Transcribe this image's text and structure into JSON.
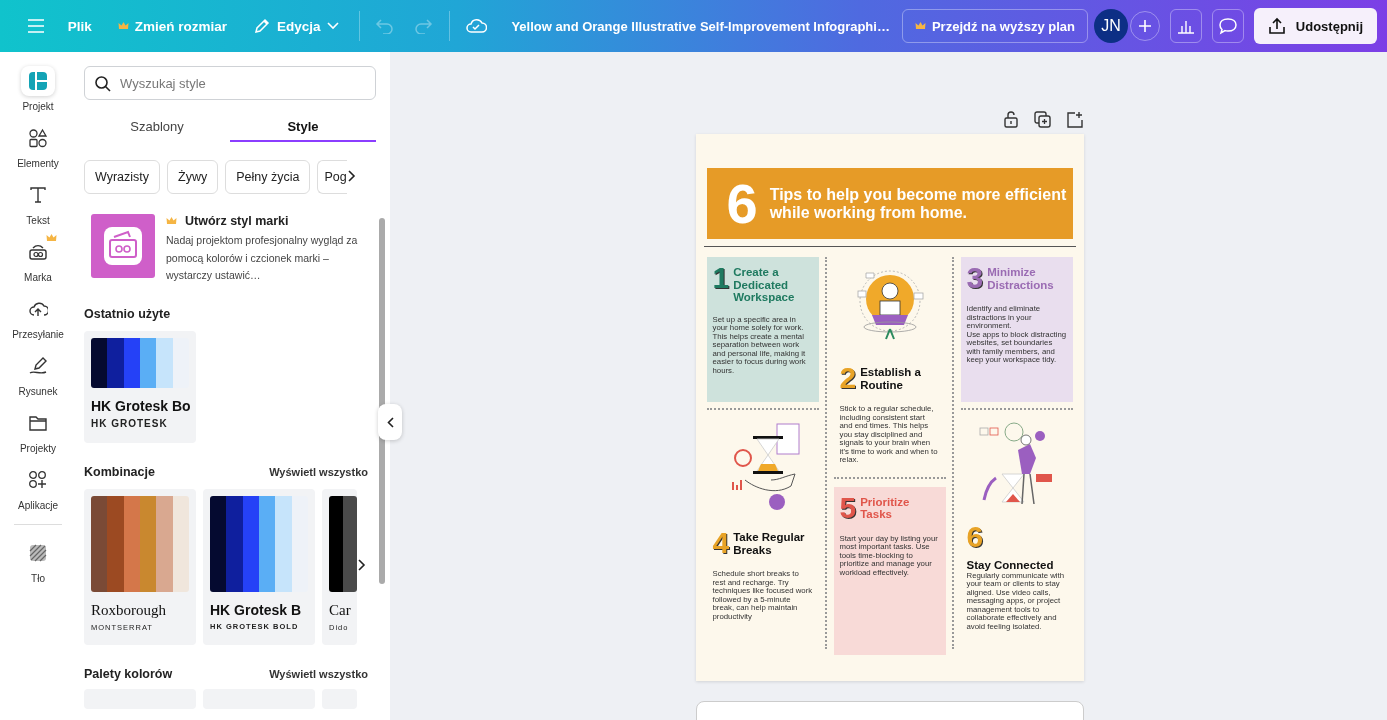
{
  "topbar": {
    "menu": [
      {
        "label": "Plik",
        "kind": "plain"
      },
      {
        "label": "Zmień rozmiar",
        "kind": "premium"
      },
      {
        "label": "Edycja",
        "kind": "edit"
      }
    ],
    "history": [
      {
        "kind": "undo",
        "disabled": true
      },
      {
        "kind": "redo",
        "disabled": true
      }
    ],
    "title": "Yellow and Orange Illustrative Self-Improvement Infographi…",
    "upgrade": "Przejdź na wyższy plan",
    "avatar": "JN",
    "share": "Udostępnij"
  },
  "rail": [
    {
      "label": "Projekt",
      "kind": "design",
      "selected": true,
      "premium": false
    },
    {
      "label": "Elementy",
      "kind": "elements",
      "selected": false,
      "premium": false
    },
    {
      "label": "Tekst",
      "kind": "text",
      "selected": false,
      "premium": false
    },
    {
      "label": "Marka",
      "kind": "brand",
      "selected": false,
      "premium": true
    },
    {
      "label": "Przesyłanie",
      "kind": "upload",
      "selected": false,
      "premium": false
    },
    {
      "label": "Rysunek",
      "kind": "draw",
      "selected": false,
      "premium": false
    },
    {
      "label": "Projekty",
      "kind": "projects",
      "selected": false,
      "premium": false
    },
    {
      "label": "Aplikacje",
      "kind": "apps",
      "selected": false,
      "premium": false
    },
    {
      "label": "Tło",
      "kind": "background",
      "selected": false,
      "premium": false
    }
  ],
  "panel": {
    "search": {
      "placeholder": "Wyszukaj style"
    },
    "tabs": [
      {
        "label": "Szablony",
        "selected": false
      },
      {
        "label": "Style",
        "selected": true
      }
    ],
    "chips": [
      "Wyrazisty",
      "Żywy",
      "Pełny życia",
      "Pog"
    ],
    "brand": {
      "title": "Utwórz styl marki",
      "text": "Nadaj projektom profesjonalny wygląd za pomocą kolorów i czcionek marki – wystarczy ustawić…"
    },
    "recent": {
      "title": "Ostatnio użyte",
      "items": [
        {
          "swatches": [
            {
              "color": "#050a30"
            },
            {
              "color": "#0f1f9e"
            },
            {
              "color": "#2541f7"
            },
            {
              "color": "#5aaef5"
            },
            {
              "color": "#c6e4fb"
            },
            {
              "color": "#eef2f8"
            }
          ],
          "font": "HK Grotesk Bo",
          "subfont": "HK GROTESK",
          "kind": "sans"
        }
      ]
    },
    "combos": {
      "title": "Kombinacje",
      "link": "Wyświetl wszystko",
      "items": [
        {
          "swatches": [
            {
              "color": "#7a4a36"
            },
            {
              "color": "#9c4a22"
            },
            {
              "color": "#d4774a"
            },
            {
              "color": "#c9882f"
            },
            {
              "color": "#d9a890"
            },
            {
              "color": "#f0e6dc"
            }
          ],
          "font": "Roxborough",
          "subfont": "MONTSERRAT",
          "kind": "serif"
        },
        {
          "swatches": [
            {
              "color": "#050a30"
            },
            {
              "color": "#0f1f9e"
            },
            {
              "color": "#2541f7"
            },
            {
              "color": "#5aaef5"
            },
            {
              "color": "#c6e4fb"
            },
            {
              "color": "#eef2f8"
            }
          ],
          "font": "HK Grotesk B",
          "subfont": "HK GROTESK BOLD",
          "kind": "sans"
        },
        {
          "swatches": [
            {
              "color": "#000000"
            },
            {
              "color": "#4a4a4a"
            }
          ],
          "font": "Car",
          "subfont": "Dido",
          "kind": "serif"
        }
      ]
    },
    "palettes": {
      "title": "Palety kolorów",
      "link": "Wyświetl wszystko"
    }
  },
  "infographic": {
    "number": "6",
    "title": "Tips to help you become more efficient while working from home.",
    "columns": [
      [
        {
          "number": "1",
          "title": "Create a Dedicated Workspace",
          "kind": "card",
          "color": "#1f7a60",
          "paragraphs": [
            "Set up a specific area in your home solely for work.",
            "This helps create a mental separation between work and personal life, making it easier to focus during work hours."
          ]
        },
        {
          "number": "4",
          "title": "Take Regular Breaks",
          "kind": "plain",
          "color": "#e8a326",
          "paragraphs": [
            "Schedule short breaks to rest and recharge. Try techniques like focused work followed by a 5-minute break, can help maintain productivity"
          ]
        }
      ],
      [
        {
          "number": "2",
          "title": "Establish a Routine",
          "kind": "plain",
          "color": "#e8a326",
          "paragraphs": [
            "Stick to a regular schedule, including consistent start and end times. This helps you stay disciplined and signals to your brain when it's time to work and when to relax."
          ]
        },
        {
          "number": "5",
          "title": "Prioritize Tasks",
          "kind": "card",
          "color": "#e0564b",
          "paragraphs": [
            "Start your day by listing your most important tasks. Use tools time-blocking to prioritize and manage your workload effectively."
          ]
        }
      ],
      [
        {
          "number": "3",
          "title": "Minimize Distractions",
          "kind": "card",
          "color": "#9a6bb3",
          "paragraphs": [
            "Identify and eliminate distractions in your environment.",
            "Use apps to block distracting websites, set boundaries with family members, and keep your workspace tidy."
          ]
        },
        {
          "number": "6",
          "title": "Stay Connected",
          "kind": "stacked",
          "color": "#e8a326",
          "paragraphs": [
            "Regularly communicate with your team or clients to stay aligned. Use video calls, messaging apps, or project management tools to collaborate effectively and avoid feeling isolated."
          ]
        }
      ]
    ]
  }
}
